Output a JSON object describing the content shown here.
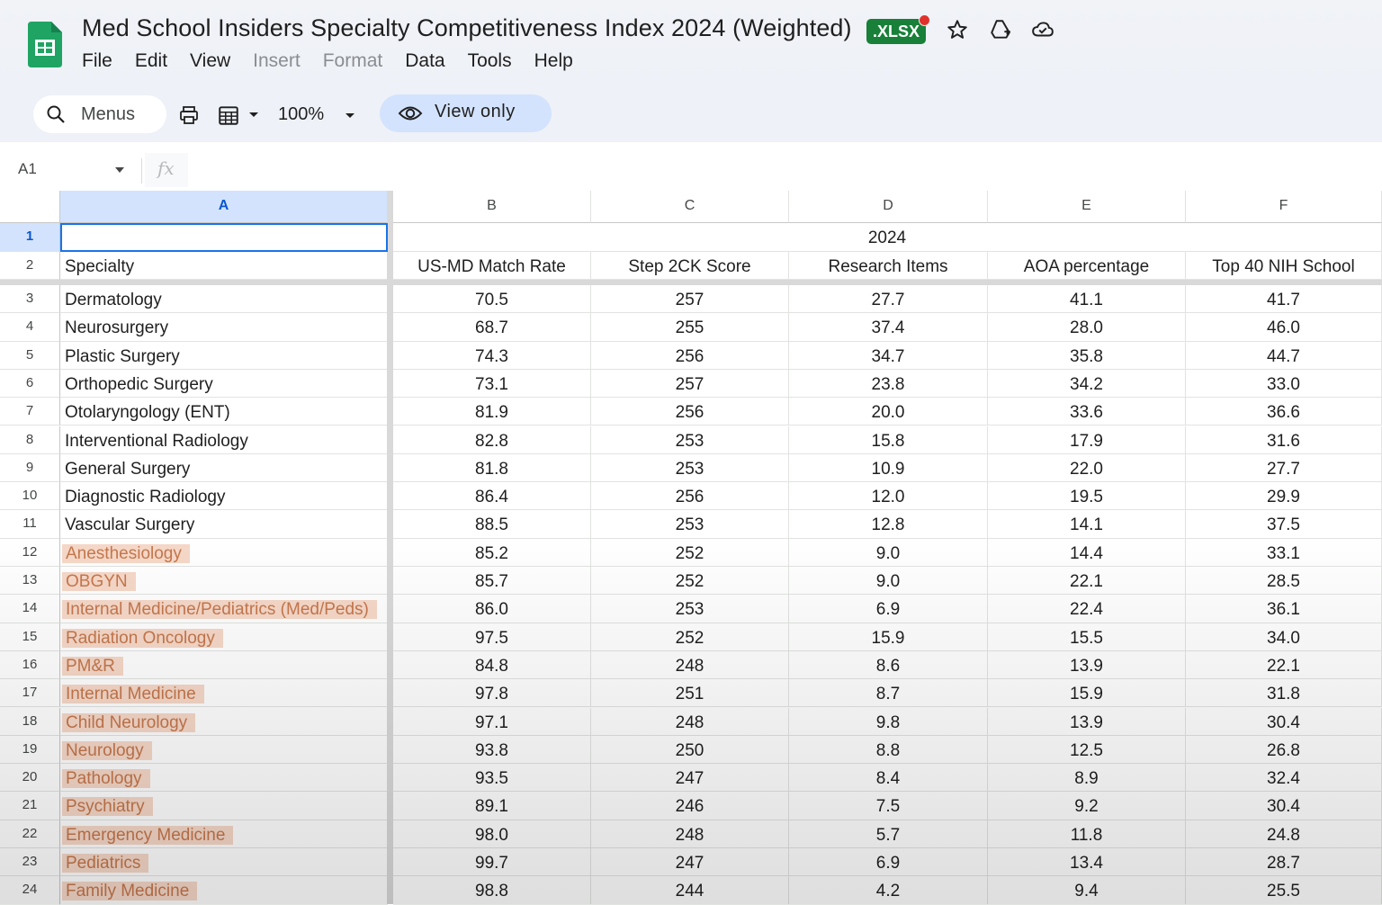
{
  "app": {
    "title": "Med School Insiders Specialty Competitiveness Index 2024 (Weighted)",
    "badge": ".XLSX",
    "menu": [
      {
        "label": "File",
        "disabled": false
      },
      {
        "label": "Edit",
        "disabled": false
      },
      {
        "label": "View",
        "disabled": false
      },
      {
        "label": "Insert",
        "disabled": true
      },
      {
        "label": "Format",
        "disabled": true
      },
      {
        "label": "Data",
        "disabled": false
      },
      {
        "label": "Tools",
        "disabled": false
      },
      {
        "label": "Help",
        "disabled": false
      }
    ]
  },
  "toolbar": {
    "menus_label": "Menus",
    "zoom": "100%",
    "view_only_label": "View only"
  },
  "formula_bar": {
    "cell_ref": "A1",
    "fx": "fx"
  },
  "colors": {
    "accent": "#1a73e8",
    "highlight_bg": "#f6d8c8",
    "highlight_text": "#c5774c",
    "xlsx_green": "#188038"
  },
  "sheet": {
    "columns": [
      "A",
      "B",
      "C",
      "D",
      "E",
      "F"
    ],
    "group_header": "2024",
    "headers": [
      "Specialty",
      "US-MD Match Rate",
      "Step 2CK Score",
      "Research Items",
      "AOA percentage",
      "Top 40 NIH School"
    ],
    "rows": [
      {
        "n": "3",
        "specialty": "Dermatology",
        "highlight": false,
        "values": [
          "70.5",
          "257",
          "27.7",
          "41.1",
          "41.7"
        ]
      },
      {
        "n": "4",
        "specialty": "Neurosurgery",
        "highlight": false,
        "values": [
          "68.7",
          "255",
          "37.4",
          "28.0",
          "46.0"
        ]
      },
      {
        "n": "5",
        "specialty": "Plastic Surgery",
        "highlight": false,
        "values": [
          "74.3",
          "256",
          "34.7",
          "35.8",
          "44.7"
        ]
      },
      {
        "n": "6",
        "specialty": "Orthopedic Surgery",
        "highlight": false,
        "values": [
          "73.1",
          "257",
          "23.8",
          "34.2",
          "33.0"
        ]
      },
      {
        "n": "7",
        "specialty": "Otolaryngology (ENT)",
        "highlight": false,
        "values": [
          "81.9",
          "256",
          "20.0",
          "33.6",
          "36.6"
        ]
      },
      {
        "n": "8",
        "specialty": "Interventional Radiology",
        "highlight": false,
        "values": [
          "82.8",
          "253",
          "15.8",
          "17.9",
          "31.6"
        ]
      },
      {
        "n": "9",
        "specialty": "General Surgery",
        "highlight": false,
        "values": [
          "81.8",
          "253",
          "10.9",
          "22.0",
          "27.7"
        ]
      },
      {
        "n": "10",
        "specialty": "Diagnostic Radiology",
        "highlight": false,
        "values": [
          "86.4",
          "256",
          "12.0",
          "19.5",
          "29.9"
        ]
      },
      {
        "n": "11",
        "specialty": "Vascular Surgery",
        "highlight": false,
        "values": [
          "88.5",
          "253",
          "12.8",
          "14.1",
          "37.5"
        ]
      },
      {
        "n": "12",
        "specialty": "Anesthesiology",
        "highlight": true,
        "values": [
          "85.2",
          "252",
          "9.0",
          "14.4",
          "33.1"
        ]
      },
      {
        "n": "13",
        "specialty": "OBGYN",
        "highlight": true,
        "values": [
          "85.7",
          "252",
          "9.0",
          "22.1",
          "28.5"
        ]
      },
      {
        "n": "14",
        "specialty": "Internal Medicine/Pediatrics (Med/Peds)",
        "highlight": true,
        "values": [
          "86.0",
          "253",
          "6.9",
          "22.4",
          "36.1"
        ]
      },
      {
        "n": "15",
        "specialty": "Radiation Oncology",
        "highlight": true,
        "values": [
          "97.5",
          "252",
          "15.9",
          "15.5",
          "34.0"
        ]
      },
      {
        "n": "16",
        "specialty": "PM&R",
        "highlight": true,
        "values": [
          "84.8",
          "248",
          "8.6",
          "13.9",
          "22.1"
        ]
      },
      {
        "n": "17",
        "specialty": "Internal Medicine",
        "highlight": true,
        "values": [
          "97.8",
          "251",
          "8.7",
          "15.9",
          "31.8"
        ]
      },
      {
        "n": "18",
        "specialty": "Child Neurology",
        "highlight": true,
        "values": [
          "97.1",
          "248",
          "9.8",
          "13.9",
          "30.4"
        ]
      },
      {
        "n": "19",
        "specialty": "Neurology",
        "highlight": true,
        "values": [
          "93.8",
          "250",
          "8.8",
          "12.5",
          "26.8"
        ]
      },
      {
        "n": "20",
        "specialty": "Pathology",
        "highlight": true,
        "values": [
          "93.5",
          "247",
          "8.4",
          "8.9",
          "32.4"
        ]
      },
      {
        "n": "21",
        "specialty": "Psychiatry",
        "highlight": true,
        "values": [
          "89.1",
          "246",
          "7.5",
          "9.2",
          "30.4"
        ]
      },
      {
        "n": "22",
        "specialty": "Emergency Medicine",
        "highlight": true,
        "values": [
          "98.0",
          "248",
          "5.7",
          "11.8",
          "24.8"
        ]
      },
      {
        "n": "23",
        "specialty": "Pediatrics",
        "highlight": true,
        "values": [
          "99.7",
          "247",
          "6.9",
          "13.4",
          "28.7"
        ]
      },
      {
        "n": "24",
        "specialty": "Family Medicine",
        "highlight": true,
        "values": [
          "98.8",
          "244",
          "4.2",
          "9.4",
          "25.5"
        ]
      }
    ]
  }
}
